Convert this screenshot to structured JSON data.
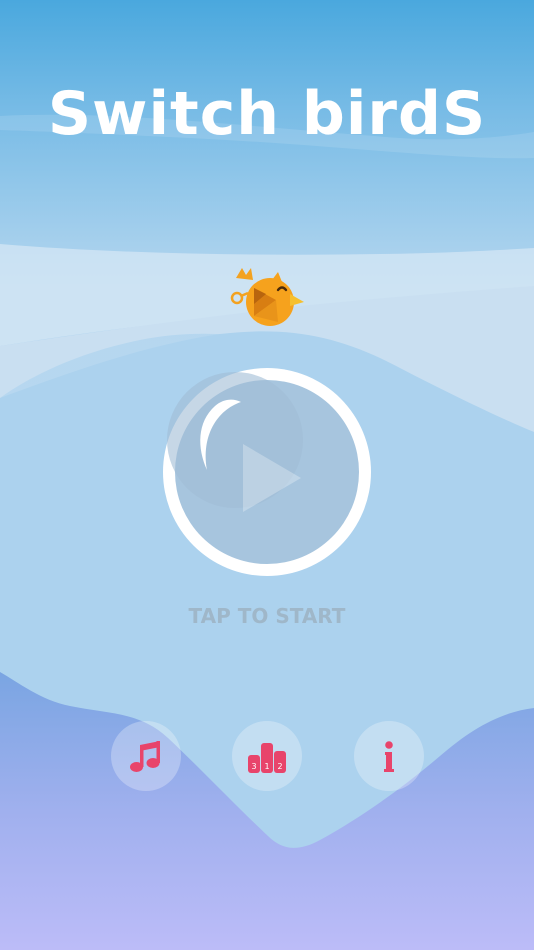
{
  "app": {
    "title": "Switch birdS"
  },
  "main": {
    "start_label": "TAP TO START"
  },
  "bottom_bar": {
    "music": {
      "icon": "music-note-icon"
    },
    "leaderboard": {
      "icon": "podium-icon",
      "places": [
        "3",
        "1",
        "2"
      ]
    },
    "info": {
      "icon": "info-icon"
    }
  },
  "colors": {
    "sky_top": "#4aa8de",
    "sky_light": "#c6def2",
    "hill": "#acd2ee",
    "mountain_bottom": "#bbbcf7",
    "icon_accent": "#e8446b",
    "bird_orange": "#f6a21d"
  }
}
